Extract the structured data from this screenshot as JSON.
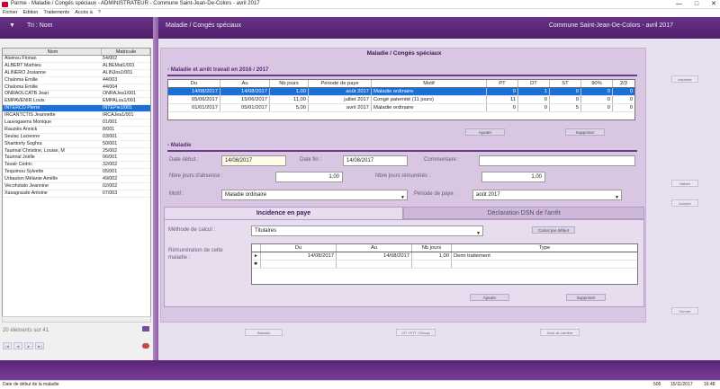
{
  "window": {
    "title": "Parme - Maladie / Congés spéciaux - ADMINISTRATEUR - Commune Saint-Jean-De-Colors - avril 2017",
    "min": "—",
    "max": "□",
    "close": "✕"
  },
  "menu": [
    "Fichier",
    "Edition",
    "Traitements",
    "Accès à",
    "?"
  ],
  "header": {
    "sort_label": "Tri : Nom",
    "screen_title": "Maladie / Congés spéciaux",
    "context": "Commune Saint-Jean-De-Colors - avril 2017"
  },
  "employees": {
    "columns": [
      "Nom",
      "Matricule"
    ],
    "rows": [
      [
        "Alvéreu Florian",
        "54/002"
      ],
      [
        "ALBERT Mathieu",
        "ALBEMat1/001"
      ],
      [
        "ALINERO Josianne",
        "ALINJos1/001"
      ],
      [
        "Chaloma Emilie",
        "44/003"
      ],
      [
        "Chaloma Emilie",
        "44/004"
      ],
      [
        "ONRAOLCATB Jean",
        "ONRAJea1/001"
      ],
      [
        "EMPAVENIR Louis",
        "EMPALou1/001"
      ],
      [
        "INTERCO Pierre",
        "INTEPie1/001"
      ],
      [
        "IRCANTCTIS Jeannette",
        "IRCAJea1/001"
      ],
      [
        "Lauvogaems Monique",
        "01/001"
      ],
      [
        "Rauziès Annick",
        "8/001"
      ],
      [
        "Seulac Lucienne",
        "03/001"
      ],
      [
        "Sharttorty Soghra",
        "50/001"
      ],
      [
        "Taurinal Christine, Louise, M",
        "25/002"
      ],
      [
        "Taurinal Joëlle",
        "06/001"
      ],
      [
        "Tavalr Cédric",
        "32/002"
      ],
      [
        "Tequimou Sylvette",
        "05/001"
      ],
      [
        "Urbauton Mélanie Amélie",
        "49/002"
      ],
      [
        "Vecohstalo Jeannine",
        "02/002"
      ],
      [
        "Xasagraude Antoine",
        "07/003"
      ]
    ],
    "selected_index": 7,
    "count_label": "20 éléments sur 41"
  },
  "nav": [
    "|◄",
    "◄",
    "►",
    "►|"
  ],
  "side_buttons": [
    "Imprimer",
    "Valider",
    "Annuler",
    "Fermer"
  ],
  "bottom_buttons": [
    "Salariés",
    "CP / RTT / Récup",
    "Suivi de carrière"
  ],
  "panel": {
    "title": "Maladie / Congés spéciaux",
    "section1": "- Maladie et arrêt travail en 2016 / 2017",
    "grid_columns": [
      "Du",
      "Au",
      "Nb jours",
      "Période de paye",
      "Motif",
      "PT",
      "DT",
      "ST",
      "90%",
      "2/3"
    ],
    "grid_rows": [
      [
        "14/08/2017",
        "14/08/2017",
        "1,00",
        "août 2017",
        "Maladie ordinaire",
        "0",
        "1",
        "0",
        "0",
        "0"
      ],
      [
        "05/06/2017",
        "15/06/2017",
        "11,00",
        "juillet 2017",
        "Congé paternité (11 jours)",
        "11",
        "0",
        "0",
        "0",
        "0"
      ],
      [
        "01/01/2017",
        "05/01/2017",
        "5,00",
        "avril 2017",
        "Maladie ordinaire",
        "0",
        "0",
        "5",
        "0",
        "0"
      ]
    ],
    "btn_add": "Ajouter",
    "btn_delete": "Supprimer",
    "section2": "- Maladie",
    "labels": {
      "date_debut": "Date début :",
      "date_fin": "Date fin :",
      "commentaire": "Commentaire :",
      "nb_absence": "Nbre jours d'absence :",
      "nb_remuneres": "Nbre jours rémunérés :",
      "motif": "Motif :",
      "periode": "Période de paye :",
      "methode": "Méthode de calcul :",
      "remuneration": "Rémunération de cette maladie :"
    },
    "values": {
      "date_debut": "14/08/2017",
      "date_fin": "14/08/2017",
      "commentaire": "",
      "nb_absence": "1,00",
      "nb_remuneres": "1,00",
      "motif": "Maladie ordinaire",
      "periode": "août 2017",
      "methode": "Titulaires"
    },
    "tabs": [
      "Incidence en paye",
      "Déclaration DSN de l'arrêt"
    ],
    "btn_calc": "Calcul par défaut",
    "rem_columns": [
      "Du",
      "Au",
      "Nb jours",
      "Type"
    ],
    "rem_rows": [
      [
        "14/08/2017",
        "14/08/2017",
        "1,00",
        "Demi traitement"
      ]
    ],
    "btn_add2": "Ajouter",
    "btn_delete2": "Supprimer"
  },
  "status": {
    "text": "Date de début de la maladie",
    "code": "506",
    "date": "15/11/2017",
    "time": "16:48"
  },
  "colors": {
    "header": "#5a2479",
    "selection": "#1a6fd8",
    "panel": "#d8c6e2"
  }
}
